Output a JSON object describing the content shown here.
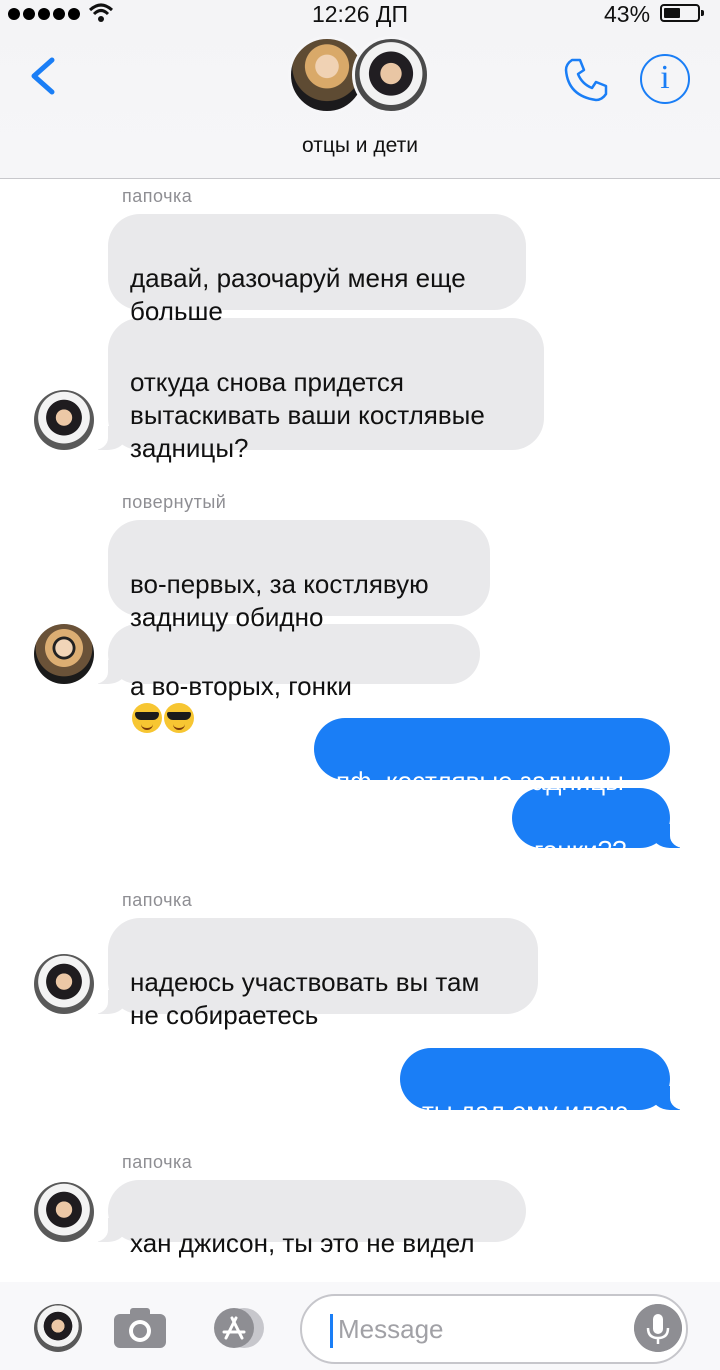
{
  "status_bar": {
    "time": "12:26 ДП",
    "battery": "43%"
  },
  "header": {
    "title": "отцы и дети"
  },
  "messages": {
    "m1": {
      "sender": "папочка",
      "text": "давай, разочаруй меня еще\nбольше"
    },
    "m2": {
      "text": "откуда снова придется\nвытаскивать ваши костлявые\nзадницы?"
    },
    "m3": {
      "sender": "повернутый",
      "text": "во-первых, за костлявую\nзадницу обидно"
    },
    "m4": {
      "text": "а во-вторых, гонки"
    },
    "m5": {
      "text": "пф, костлявые задницы"
    },
    "m6": {
      "text": "гонки??"
    },
    "m7": {
      "sender": "папочка",
      "text": "надеюсь участвовать вы там\nне собираетесь"
    },
    "m8": {
      "text": "ты дал ему идею"
    },
    "m9": {
      "sender": "папочка",
      "text": "хан джисон, ты это не видел"
    }
  },
  "input": {
    "placeholder": "Message"
  },
  "icons": {
    "back": "chevron-left-icon",
    "phone": "phone-icon",
    "info": "info-icon",
    "camera": "camera-icon",
    "apps": "app-store-icon",
    "mic": "microphone-icon",
    "emoji": "smiling-face-with-sunglasses"
  },
  "colors": {
    "accent": "#1a7ef6",
    "incoming_bubble": "#e9e9eb",
    "outgoing_text": "#ffffff"
  }
}
